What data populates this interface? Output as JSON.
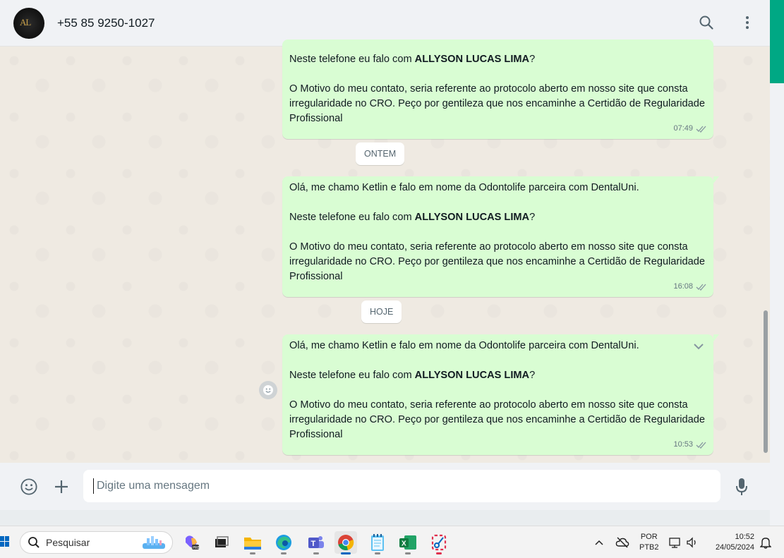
{
  "header": {
    "contact_name": "+55 85 9250-1027"
  },
  "messages": [
    {
      "p1_prefix": "Neste telefone eu falo com ",
      "p1_bold": "ALLYSON LUCAS LIMA",
      "p1_suffix": "?",
      "p2": "O Motivo do meu contato, seria referente ao protocolo aberto em nosso site que consta irregularidade no CRO. Peço por gentileza que nos encaminhe a Certidão de Regularidade Profissional",
      "time": "07:49"
    },
    {
      "p0": "Olá, me chamo Ketlin e falo em nome da Odontolife parceira com DentalUni.",
      "p1_prefix": "Neste telefone eu falo com ",
      "p1_bold": "ALLYSON LUCAS LIMA",
      "p1_suffix": "?",
      "p2": "O Motivo do meu contato, seria referente ao protocolo aberto em nosso site que consta irregularidade no CRO. Peço por gentileza que nos encaminhe a Certidão de Regularidade Profissional",
      "time": "16:08"
    },
    {
      "p0": "Olá, me chamo Ketlin e falo em nome da Odontolife parceira com DentalUni.",
      "p1_prefix": "Neste telefone eu falo com ",
      "p1_bold": "ALLYSON LUCAS LIMA",
      "p1_suffix": "?",
      "p2": "O Motivo do meu contato, seria referente ao protocolo aberto em nosso site que consta irregularidade no CRO. Peço por gentileza que nos encaminhe a Certidão de Regularidade Profissional",
      "time": "10:53"
    }
  ],
  "dividers": {
    "yesterday": "ONTEM",
    "today": "HOJE"
  },
  "compose": {
    "placeholder": "Digite uma mensagem"
  },
  "taskbar": {
    "search_label": "Pesquisar",
    "lang_line1": "POR",
    "lang_line2": "PTB2",
    "time": "10:52",
    "date": "24/05/2024",
    "apps": [
      "copilot-icon",
      "task-view-icon",
      "file-explorer-icon",
      "edge-icon",
      "teams-icon",
      "chrome-icon",
      "notepad-icon",
      "excel-icon",
      "snipping-tool-icon"
    ]
  },
  "colors": {
    "bubble_out": "#d9fdd3",
    "chat_bg": "#efeae2",
    "accent": "#00a884"
  }
}
